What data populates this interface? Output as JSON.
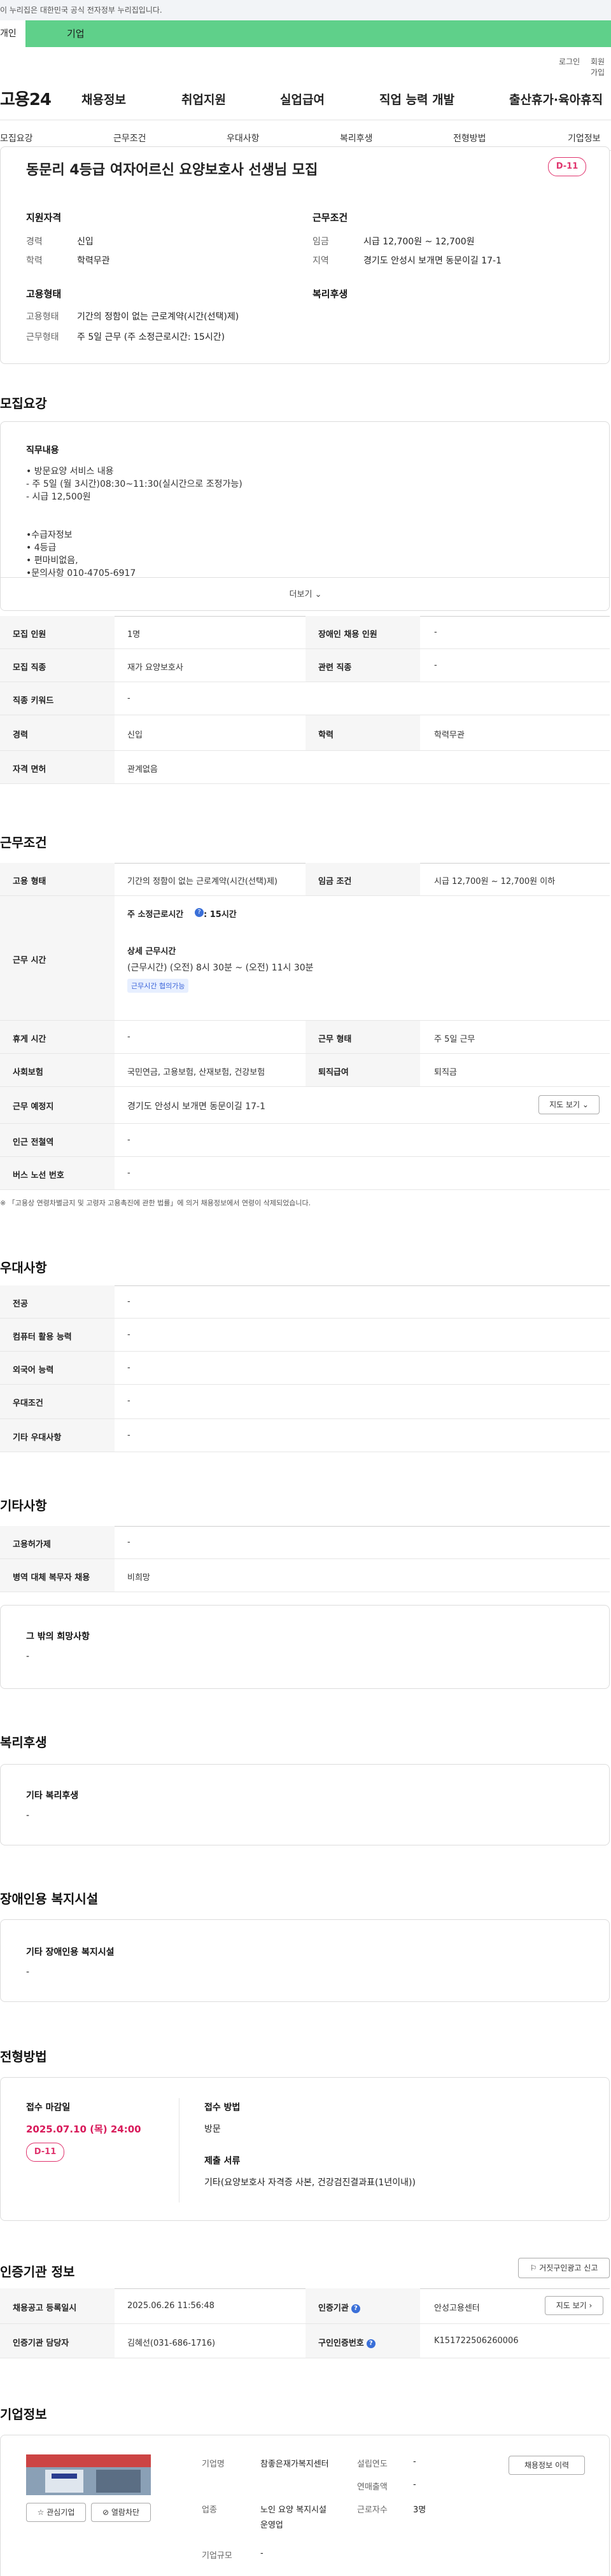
{
  "gov_banner": "이 누리집은 대한민국 공식 전자정부 누리집입니다.",
  "tabs": {
    "personal": "개인",
    "company": "기업"
  },
  "util": {
    "login": "로그인",
    "join": "회원가입"
  },
  "logo": "고용24",
  "gnb": [
    "채용정보",
    "취업지원",
    "실업급여",
    "직업 능력 개발",
    "출산휴가·육아휴직"
  ],
  "snb": [
    "모집요강",
    "근무조건",
    "우대사항",
    "복리후생",
    "전형방법",
    "기업정보"
  ],
  "job": {
    "title": "동문리 4등급 여자어르신 요양보호사 선생님 모집",
    "dday": "D-11",
    "req_head": "지원자격",
    "req": [
      {
        "k": "경력",
        "v": "신입"
      },
      {
        "k": "학력",
        "v": "학력무관"
      }
    ],
    "cond_head": "근무조건",
    "cond": [
      {
        "k": "임금",
        "v": "시급 12,700원 ~ 12,700원"
      },
      {
        "k": "지역",
        "v": "경기도 안성시 보개면 동문이길 17-1"
      }
    ],
    "emp_head": "고용형태",
    "emp": [
      {
        "k": "고용형태",
        "v": "기간의 정함이 없는 근로계약(시간(선택)제)"
      },
      {
        "k": "근무형태",
        "v": "주 5일 근무 (주 소정근로시간: 15시간)"
      }
    ],
    "welfare_head": "복리후생"
  },
  "recruit": {
    "heading": "모집요강",
    "desc_title": "직무내용",
    "desc_lines": [
      "• 방문요양 서비스 내용",
      "- 주 5일 (월 3시간)08:30~11:30(실시간으로 조정가능)",
      "- 시급 12,500원",
      "",
      "",
      "•수급자정보",
      "• 4등급",
      "• 편마비없음,",
      "•문의사항 010-4705-6917"
    ],
    "more": "더보기",
    "table": [
      {
        "h1": "모집 인원",
        "v1": "1명",
        "h2": "장애인 채용 인원",
        "v2": "-"
      },
      {
        "h1": "모집 직종",
        "v1": "재가 요양보호사",
        "h2": "관련 직종",
        "v2": "-"
      },
      {
        "h1": "직종 키워드",
        "v1": "-",
        "h2": "",
        "v2": ""
      },
      {
        "h1": "경력",
        "v1": "신입",
        "h2": "학력",
        "v2": "학력무관"
      },
      {
        "h1": "자격 면허",
        "v1": "관계없음",
        "h2": "",
        "v2": ""
      }
    ]
  },
  "work": {
    "heading": "근무조건",
    "emp_type_h": "고용 형태",
    "emp_type_v": "기간의 정함이 없는 근로계약(시간(선택)제)",
    "wage_h": "임금 조건",
    "wage_v": "시급 12,700원 ~ 12,700원 이하",
    "hours_h": "근무 시간",
    "hours_week_label": "주 소정근로시간",
    "hours_week_val": ": 15시간",
    "hours_detail_label": "상세 근무시간",
    "hours_detail_val": "(근무시간) (오전) 8시 30분 ~ (오전) 11시 30분",
    "hours_tag": "근무시간 협의가능",
    "rows": [
      {
        "h1": "휴게 시간",
        "v1": "-",
        "h2": "근무 형태",
        "v2": "주 5일 근무"
      },
      {
        "h1": "사회보험",
        "v1": "국민연금, 고용보험, 산재보험, 건강보험",
        "h2": "퇴직급여",
        "v2": "퇴직금"
      }
    ],
    "place_h": "근무 예정지",
    "place_v": "경기도 안성시 보개면 동문이길 17-1",
    "map_btn": "지도 보기",
    "station_h": "인근 전철역",
    "station_v": "-",
    "bus_h": "버스 노선 번호",
    "bus_v": "-",
    "notice": "※ 「고용상 연령차별금지 및 고령자 고용촉진에 관한 법률」에 의거 채용정보에서 연령이 삭제되었습니다."
  },
  "pref": {
    "heading": "우대사항",
    "rows": [
      {
        "h": "전공",
        "v": "-"
      },
      {
        "h": "컴퓨터 활용 능력",
        "v": "-"
      },
      {
        "h": "외국어 능력",
        "v": "-"
      },
      {
        "h": "우대조건",
        "v": "-"
      },
      {
        "h": "기타 우대사항",
        "v": "-"
      }
    ]
  },
  "etc": {
    "heading": "기타사항",
    "rows": [
      {
        "h": "고용허가제",
        "v": "-"
      },
      {
        "h": "병역 대체 복무자 채용",
        "v": "비희망"
      }
    ],
    "hope_title": "그 밖의 희망사항",
    "hope_val": "-"
  },
  "welfare": {
    "heading": "복리후생",
    "title": "기타 복리후생",
    "val": "-"
  },
  "facility": {
    "heading": "장애인용 복지시설",
    "title": "기타 장애인용 복지시설",
    "val": "-"
  },
  "selection": {
    "heading": "전형방법",
    "deadline_label": "접수 마감일",
    "deadline": "2025.07.10 (목) 24:00",
    "dday": "D-11",
    "method_label": "접수 방법",
    "method": "방문",
    "docs_label": "제출 서류",
    "docs": "기타(요양보호사 자격증 사본, 건강검진결과표(1년이내))"
  },
  "agency": {
    "heading": "인증기관 정보",
    "report_btn": "거짓구인광고 신고",
    "reg_h": "채용공고 등록일시",
    "reg_v": "2025.06.26 11:56:48",
    "org_h": "인증기관",
    "org_v": "안성고용센터",
    "map_btn": "지도 보기",
    "mgr_h": "인증기관 담당자",
    "mgr_v": "김혜선(031-686-1716)",
    "num_h": "구인인증번호",
    "num_v": "K151722506260006"
  },
  "company": {
    "heading": "기업정보",
    "name_h": "기업명",
    "name_v": "참좋은재가복지센터",
    "year_h": "설립연도",
    "year_v": "-",
    "sales_h": "연매출액",
    "sales_v": "-",
    "biz_h": "업종",
    "biz_v": "노인 요양 복지시설 운영업",
    "staff_h": "근로자수",
    "staff_v": "3명",
    "size_h": "기업규모",
    "size_v": "-",
    "fav_btn": "관심기업",
    "block_btn": "열람차단",
    "history_btn": "채용정보 이력"
  }
}
